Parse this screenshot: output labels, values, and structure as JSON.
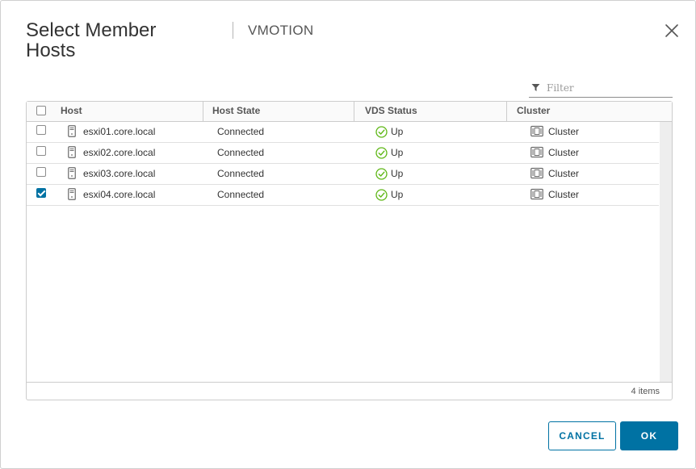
{
  "dialog": {
    "title": "Select Member Hosts",
    "subtitle": "VMOTION"
  },
  "filter": {
    "placeholder": "Filter",
    "value": ""
  },
  "grid": {
    "columns": [
      "Host",
      "Host State",
      "VDS Status",
      "Cluster"
    ],
    "rows": [
      {
        "host": "esxi01.core.local",
        "state": "Connected",
        "vds": "Up",
        "cluster": "Cluster",
        "checked": false
      },
      {
        "host": "esxi02.core.local",
        "state": "Connected",
        "vds": "Up",
        "cluster": "Cluster",
        "checked": false
      },
      {
        "host": "esxi03.core.local",
        "state": "Connected",
        "vds": "Up",
        "cluster": "Cluster",
        "checked": false
      },
      {
        "host": "esxi04.core.local",
        "state": "Connected",
        "vds": "Up",
        "cluster": "Cluster",
        "checked": true
      }
    ],
    "footer": "4 items"
  },
  "buttons": {
    "cancel": "CANCEL",
    "ok": "OK"
  },
  "icons": {
    "close": "close-icon",
    "filter": "filter-icon",
    "host": "host-server-icon",
    "status": "status-ok-icon",
    "cluster": "cluster-icon"
  },
  "colors": {
    "primary": "#0072a3",
    "success": "#5eb715",
    "border": "#cccccc"
  }
}
